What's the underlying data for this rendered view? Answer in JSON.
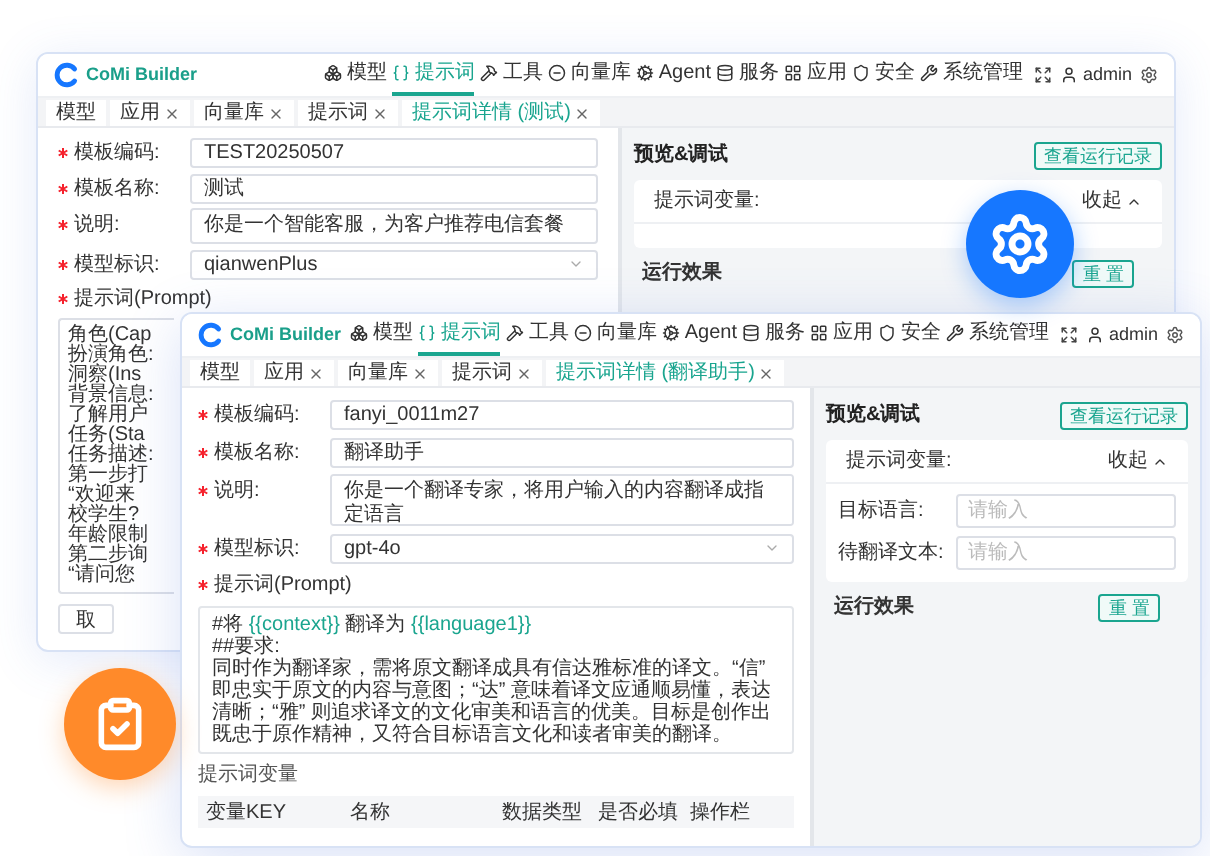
{
  "back_window": {
    "app_name": "CoMi Builder",
    "nav": [
      {
        "label": "模型",
        "selected": false
      },
      {
        "label": "提示词",
        "selected": true
      },
      {
        "label": "工具",
        "selected": false
      },
      {
        "label": "向量库",
        "selected": false
      },
      {
        "label": "Agent",
        "selected": false
      },
      {
        "label": "服务",
        "selected": false
      },
      {
        "label": "应用",
        "selected": false
      },
      {
        "label": "安全",
        "selected": false
      },
      {
        "label": "系统管理",
        "selected": false
      }
    ],
    "user": "admin",
    "tabs": [
      {
        "label": "模型",
        "closable": false,
        "selected": false
      },
      {
        "label": "应用",
        "closable": true,
        "selected": false
      },
      {
        "label": "向量库",
        "closable": true,
        "selected": false
      },
      {
        "label": "提示词",
        "closable": true,
        "selected": false
      },
      {
        "label": "提示词详情 (测试)",
        "closable": true,
        "selected": true
      }
    ],
    "fields": [
      {
        "label": "模板编码:",
        "required": true,
        "kind": "text",
        "value": "TEST20250507"
      },
      {
        "label": "模板名称:",
        "required": true,
        "kind": "text",
        "value": "测试"
      },
      {
        "label": "说明:",
        "required": true,
        "kind": "textarea",
        "value": "你是一个智能客服，为客户推荐电信套餐"
      },
      {
        "label": "模型标识:",
        "required": true,
        "kind": "select",
        "value": "qianwenPlus"
      }
    ],
    "prompt_label": "提示词(Prompt)",
    "prompt_required": true,
    "prompt_lines": [
      "角色(Cap",
      "扮演角色:",
      "洞察(Ins",
      "背景信息:",
      "了解用户",
      "任务(Sta",
      "任务描述:",
      "第一步打",
      "“欢迎来",
      "校学生?",
      "年龄限制",
      "第二步询",
      "“请问您"
    ],
    "cancel_button": "取",
    "preview": {
      "title": "预览&调试",
      "history_button": "查看运行记录",
      "variables_title": "提示词变量:",
      "collapse": "收起",
      "result_title": "运行效果",
      "reset_button": "重 置"
    }
  },
  "front_window": {
    "app_name": "CoMi Builder",
    "nav": [
      {
        "label": "模型",
        "selected": false
      },
      {
        "label": "提示词",
        "selected": true
      },
      {
        "label": "工具",
        "selected": false
      },
      {
        "label": "向量库",
        "selected": false
      },
      {
        "label": "Agent",
        "selected": false
      },
      {
        "label": "服务",
        "selected": false
      },
      {
        "label": "应用",
        "selected": false
      },
      {
        "label": "安全",
        "selected": false
      },
      {
        "label": "系统管理",
        "selected": false
      }
    ],
    "user": "admin",
    "tabs": [
      {
        "label": "模型",
        "closable": false,
        "selected": false
      },
      {
        "label": "应用",
        "closable": true,
        "selected": false
      },
      {
        "label": "向量库",
        "closable": true,
        "selected": false
      },
      {
        "label": "提示词",
        "closable": true,
        "selected": false
      },
      {
        "label": "提示词详情 (翻译助手)",
        "closable": true,
        "selected": true
      }
    ],
    "fields": [
      {
        "label": "模板编码:",
        "required": true,
        "kind": "text",
        "value": "fanyi_0011m27"
      },
      {
        "label": "模板名称:",
        "required": true,
        "kind": "text",
        "value": "翻译助手"
      },
      {
        "label": "说明:",
        "required": true,
        "kind": "textarea",
        "value": "你是一个翻译专家，将用户输入的内容翻译成指定语言"
      },
      {
        "label": "模型标识:",
        "required": true,
        "kind": "select",
        "value": "gpt-4o"
      }
    ],
    "prompt_label": "提示词(Prompt)",
    "prompt_required": true,
    "prompt_lines": [
      [
        {
          "kind": "plain",
          "text": "#将 "
        },
        {
          "kind": "variable",
          "text": "{{context}}"
        },
        {
          "kind": "plain",
          "text": " 翻译为 "
        },
        {
          "kind": "variable",
          "text": "{{language1}}"
        }
      ],
      [
        {
          "kind": "plain",
          "text": "##要求:"
        }
      ],
      [
        {
          "kind": "plain",
          "text": "同时作为翻译家，需将原文翻译成具有信达雅标准的译文。“信” 即忠实于原文的内容与意图；“达” 意味着译文应通顺易懂，表达清晰；“雅” 则追求译文的文化审美和语言的优美。目标是创作出既忠于原作精神，又符合目标语言文化和读者审美的翻译。"
        }
      ]
    ],
    "variables_label": "提示词变量",
    "table_columns": [
      "变量KEY",
      "名称",
      "数据类型",
      "是否必填",
      "操作栏"
    ],
    "preview": {
      "title": "预览&调试",
      "history_button": "查看运行记录",
      "variables_title": "提示词变量:",
      "collapse": "收起",
      "inputs": [
        {
          "label": "目标语言:",
          "placeholder": "请输入"
        },
        {
          "label": "待翻译文本:",
          "placeholder": "请输入"
        }
      ],
      "result_title": "运行效果",
      "reset_button": "重 置"
    }
  }
}
